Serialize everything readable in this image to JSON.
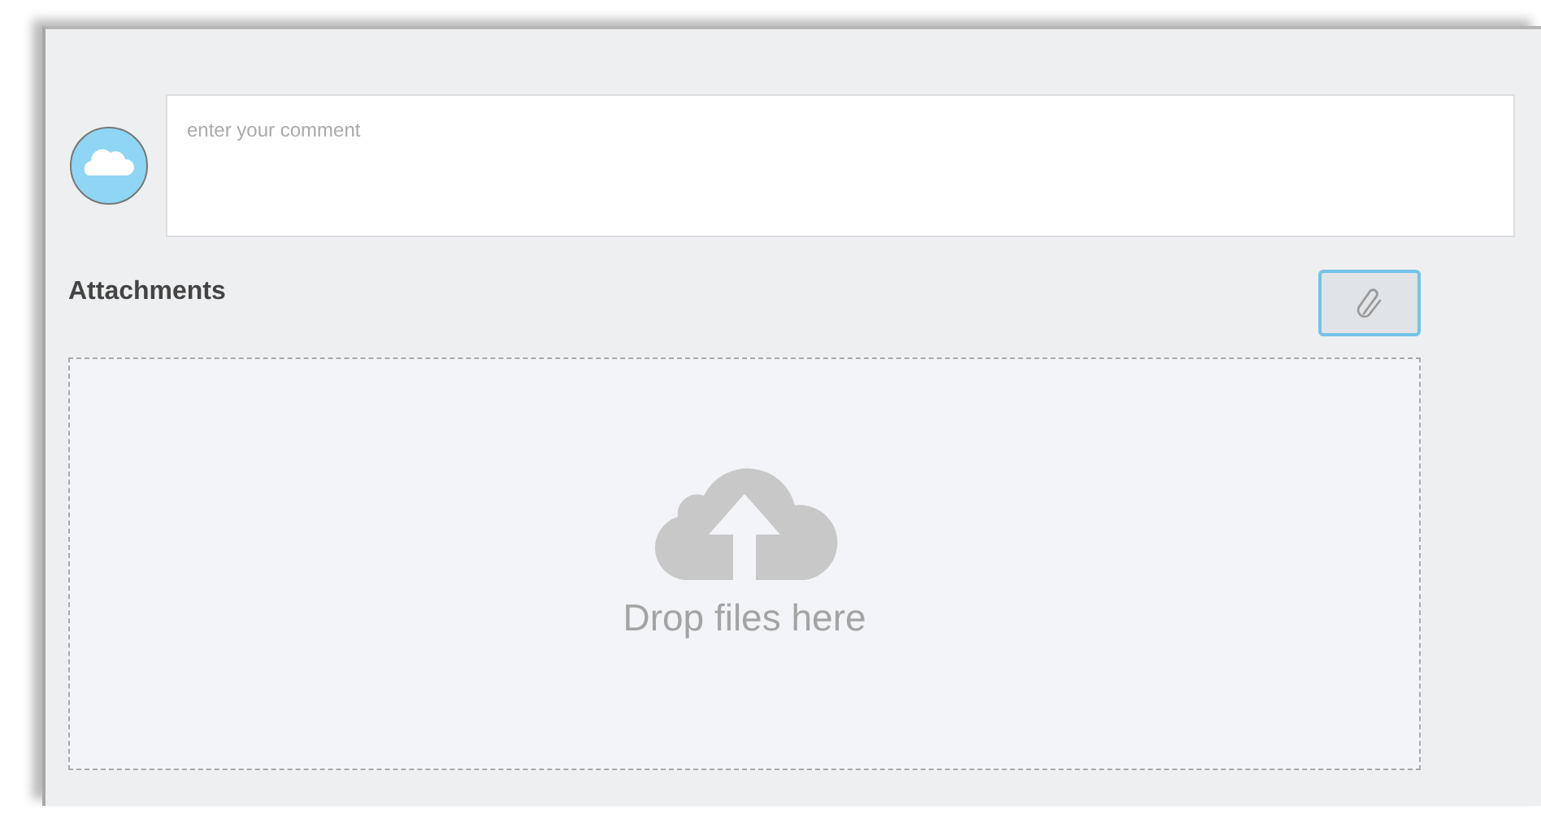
{
  "comment": {
    "placeholder": "enter your comment"
  },
  "attachments": {
    "title": "Attachments",
    "drop_text": "Drop files here"
  }
}
